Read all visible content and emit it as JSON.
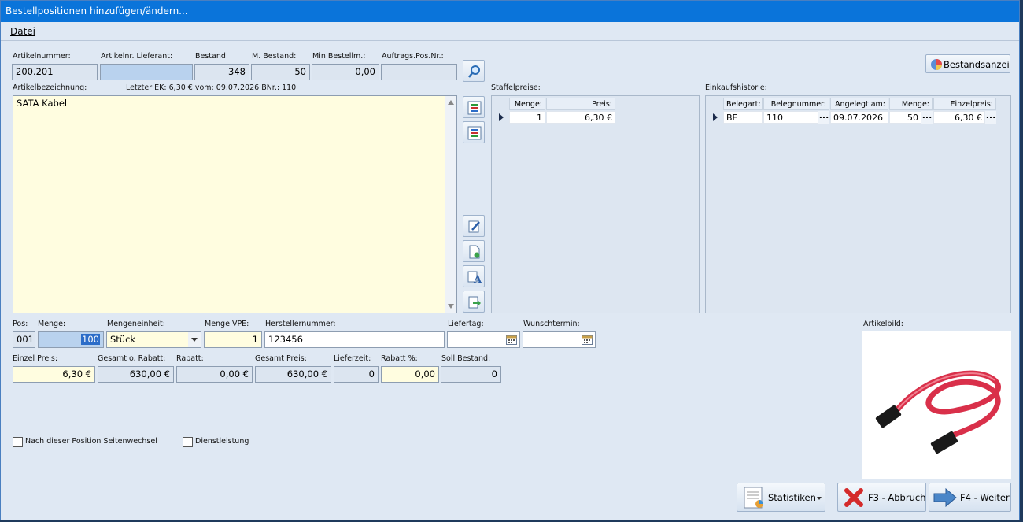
{
  "window": {
    "title": "Bestellpositionen hinzufügen/ändern..."
  },
  "menu": {
    "datei": "Datei"
  },
  "top": {
    "artikelnummer_label": "Artikelnummer:",
    "artikelnummer": "200.201",
    "artikelnr_lieferant_label": "Artikelnr. Lieferant:",
    "artikelnr_lieferant": "",
    "bestand_label": "Bestand:",
    "bestand": "348",
    "m_bestand_label": "M. Bestand:",
    "m_bestand": "50",
    "min_bestellm_label": "Min Bestellm.:",
    "min_bestellm": "0,00",
    "auftrags_pos_label": "Auftrags.Pos.Nr.:",
    "auftrags_pos": "",
    "bestandsanzeige": "Bestandsanzeige"
  },
  "bezeichnung": {
    "label": "Artikelbezeichnung:",
    "letzter_ek": "Letzter EK: 6,30 € vom: 09.07.2026 BNr.: 110",
    "text": "SATA Kabel"
  },
  "staffel": {
    "label": "Staffelpreise:",
    "headers": [
      "Menge:",
      "Preis:"
    ],
    "rows": [
      {
        "menge": "1",
        "preis": "6,30 €"
      }
    ]
  },
  "historie": {
    "label": "Einkaufshistorie:",
    "headers": [
      "Belegart:",
      "Belegnummer:",
      "Angelegt am:",
      "Menge:",
      "Einzelpreis:"
    ],
    "rows": [
      {
        "belegart": "BE",
        "belegnummer": "110",
        "datum": "09.07.2026",
        "menge": "50",
        "einzelpreis": "6,30 €"
      }
    ],
    "dots": "..."
  },
  "pos": {
    "pos_label": "Pos:",
    "pos": "001",
    "menge_label": "Menge:",
    "menge": "100",
    "einheit_label": "Mengeneinheit:",
    "einheit": "Stück",
    "vpe_label": "Menge VPE:",
    "vpe": "1",
    "hersteller_label": "Herstellernummer:",
    "hersteller": "123456",
    "liefertag_label": "Liefertag:",
    "liefertag": "",
    "wunsch_label": "Wunschtermin:",
    "wunsch": ""
  },
  "preise": {
    "einzel_label": "Einzel Preis:",
    "einzel": "6,30 €",
    "gesamt_o_label": "Gesamt o. Rabatt:",
    "gesamt_o": "630,00 €",
    "rabatt_label": "Rabatt:",
    "rabatt": "0,00 €",
    "gesamt_label": "Gesamt Preis:",
    "gesamt": "630,00 €",
    "lieferzeit_label": "Lieferzeit:",
    "lieferzeit": "0",
    "rabatt_pct_label": "Rabatt %:",
    "rabatt_pct": "0,00",
    "soll_label": "Soll Bestand:",
    "soll": "0"
  },
  "options": {
    "seitenwechsel": "Nach dieser Position Seitenwechsel",
    "dienstleistung": "Dienstleistung"
  },
  "artikelbild_label": "Artikelbild:",
  "buttons": {
    "statistiken": "Statistiken",
    "abbruch": "F3 - Abbruch",
    "weiter": "F4 - Weiter"
  }
}
